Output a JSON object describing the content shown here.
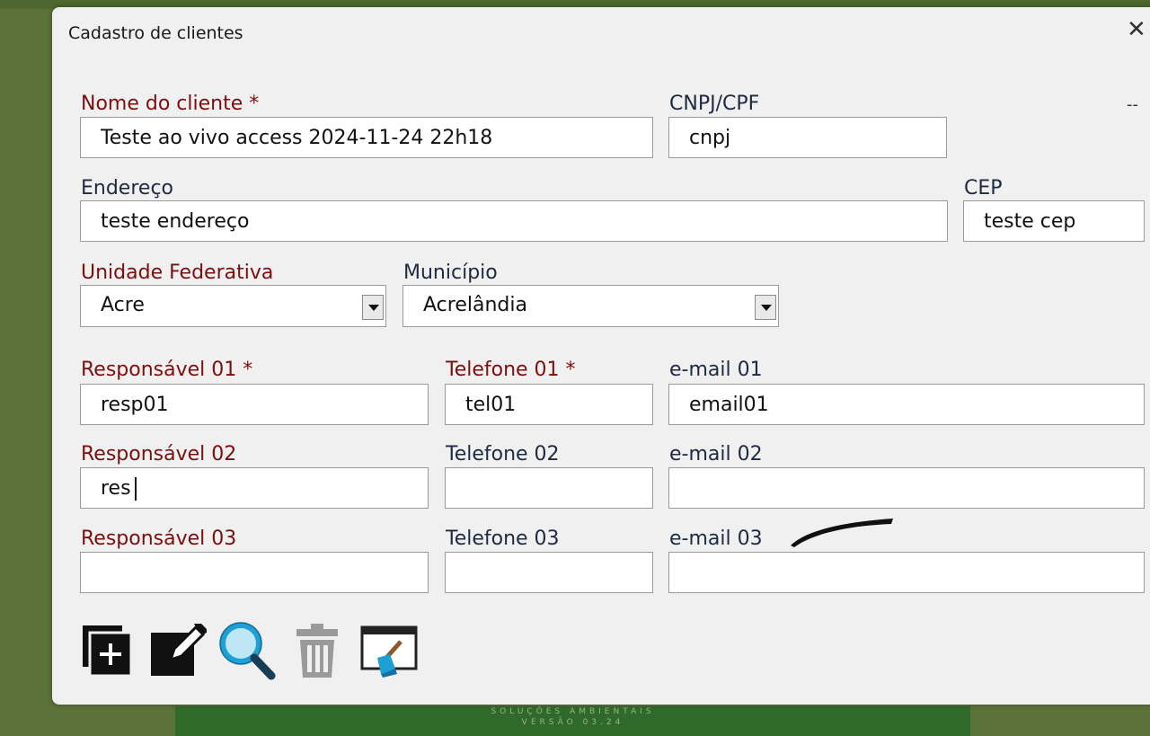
{
  "window": {
    "title": "Cadastro de clientes",
    "close_glyph": "✕",
    "dash_glyph": "--"
  },
  "background": {
    "banner_line1": "SOLUÇÕES AMBIENTAIS",
    "banner_line2": "VERSÃO 03.24"
  },
  "form": {
    "nome": {
      "label": "Nome do cliente *",
      "value": "Teste ao vivo access 2024-11-24 22h18"
    },
    "cnpj": {
      "label": "CNPJ/CPF",
      "value": "cnpj"
    },
    "endereco": {
      "label": "Endereço",
      "value": "teste endereço"
    },
    "cep": {
      "label": "CEP",
      "value": "teste cep"
    },
    "uf": {
      "label": "Unidade Federativa",
      "value": "Acre"
    },
    "municipio": {
      "label": "Município",
      "value": "Acrelândia"
    },
    "resp01": {
      "label": "Responsável 01 *",
      "value": "resp01"
    },
    "tel01": {
      "label": "Telefone 01 *",
      "value": "tel01"
    },
    "email01": {
      "label": "e-mail 01",
      "value": "email01"
    },
    "resp02": {
      "label": "Responsável 02",
      "value": "res"
    },
    "tel02": {
      "label": "Telefone 02",
      "value": ""
    },
    "email02": {
      "label": "e-mail 02",
      "value": ""
    },
    "resp03": {
      "label": "Responsável 03",
      "value": ""
    },
    "tel03": {
      "label": "Telefone 03",
      "value": ""
    },
    "email03": {
      "label": "e-mail 03",
      "value": ""
    }
  },
  "toolbar": {
    "icons": [
      "add-icon",
      "edit-icon",
      "search-icon",
      "trash-icon",
      "clear-screen-icon"
    ]
  },
  "colors": {
    "background": "#5b7238",
    "dialog": "#f0f0f0",
    "label_red": "#7a0f0f",
    "label_dark": "#1e2a40",
    "search_accent": "#1e9fd6"
  }
}
